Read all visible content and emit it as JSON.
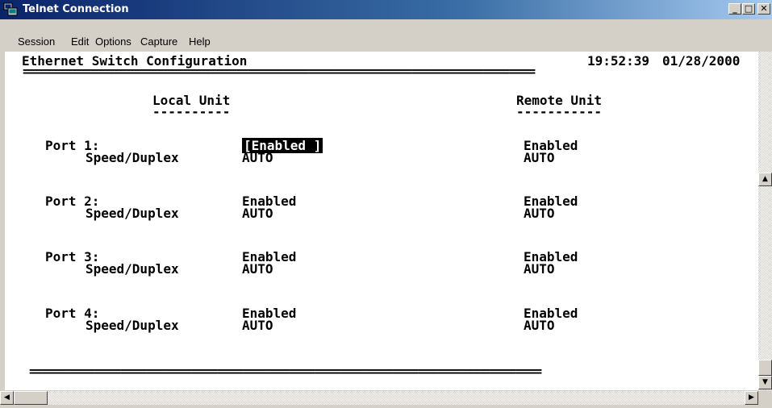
{
  "window": {
    "title": "Telnet Connection",
    "controls": {
      "minimize": "_",
      "maximize": "□",
      "close": "✕"
    }
  },
  "menu": [
    "Session",
    "Edit",
    "Options",
    "Capture",
    "Help"
  ],
  "terminal": {
    "screen_title": "Ethernet Switch Configuration",
    "time": "19:52:39",
    "date": "01/28/2000",
    "separator": "===============================================================================",
    "local_header": "Local Unit",
    "local_underline": "----------",
    "remote_header": "Remote Unit",
    "remote_underline": "-----------",
    "speed_label": "Speed/Duplex",
    "ports": [
      {
        "label": "Port 1:",
        "local_status": "[Enabled ]",
        "local_speed": "AUTO",
        "remote_status": "Enabled",
        "remote_speed": "AUTO"
      },
      {
        "label": "Port 2:",
        "local_status": "Enabled",
        "local_speed": "AUTO",
        "remote_status": "Enabled",
        "remote_speed": "AUTO"
      },
      {
        "label": "Port 3:",
        "local_status": "Enabled",
        "local_speed": "AUTO",
        "remote_status": "Enabled",
        "remote_speed": "AUTO"
      },
      {
        "label": "Port 4:",
        "local_status": "Enabled",
        "local_speed": "AUTO",
        "remote_status": "Enabled",
        "remote_speed": "AUTO"
      }
    ]
  },
  "icons": {
    "app": "telnet-computer-icon",
    "scroll_up": "▲",
    "scroll_down": "▼",
    "scroll_left": "◀",
    "scroll_right": "▶"
  },
  "colors": {
    "titlebar_start": "#0a246a",
    "titlebar_end": "#a6caf0",
    "selection_bg": "#000000"
  }
}
